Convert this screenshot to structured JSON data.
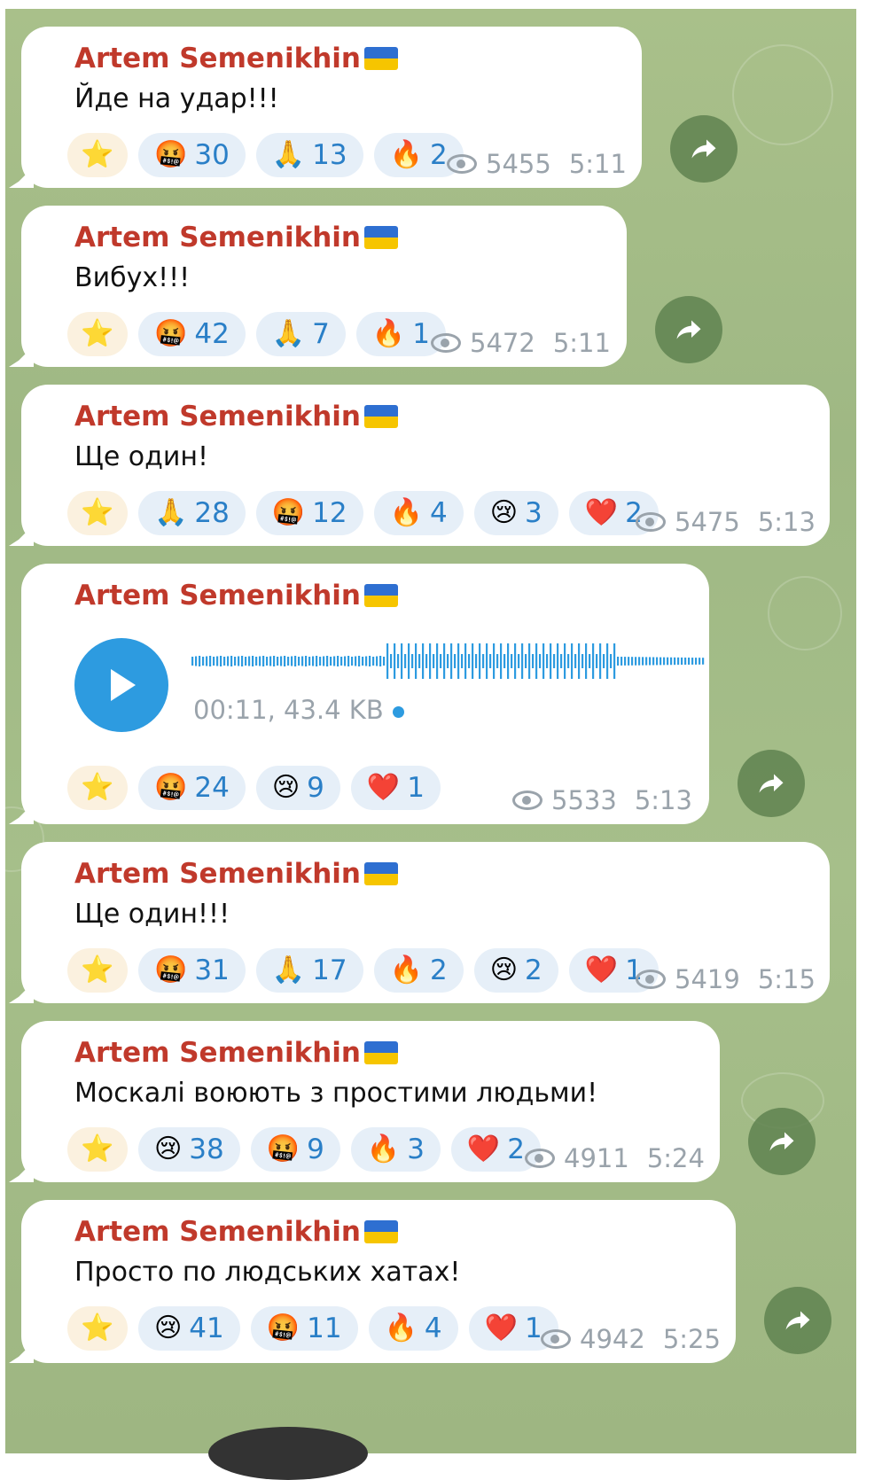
{
  "author": "Artem Semenikhin",
  "author_flag": "ukraine-flag-emoji",
  "colors": {
    "author": "#c0392b",
    "count": "#2a7fc7",
    "background": "#a6bf8a",
    "voice_play": "#2d9be0"
  },
  "messages": [
    {
      "text": "Йде на удар!!!",
      "reactions": [
        {
          "emoji": "⭐",
          "count": ""
        },
        {
          "emoji": "🤬",
          "count": "30"
        },
        {
          "emoji": "🙏",
          "count": "13"
        },
        {
          "emoji": "🔥",
          "count": "2"
        }
      ],
      "views": "5455",
      "time": "5:11"
    },
    {
      "text": "Вибух!!!",
      "reactions": [
        {
          "emoji": "⭐",
          "count": ""
        },
        {
          "emoji": "🤬",
          "count": "42"
        },
        {
          "emoji": "🙏",
          "count": "7"
        },
        {
          "emoji": "🔥",
          "count": "1"
        }
      ],
      "views": "5472",
      "time": "5:11"
    },
    {
      "text": "Ще один!",
      "reactions": [
        {
          "emoji": "⭐",
          "count": ""
        },
        {
          "emoji": "🙏",
          "count": "28"
        },
        {
          "emoji": "🤬",
          "count": "12"
        },
        {
          "emoji": "🔥",
          "count": "4"
        },
        {
          "emoji": "😢",
          "count": "3"
        },
        {
          "emoji": "❤️",
          "count": "2"
        }
      ],
      "views": "5475",
      "time": "5:13"
    },
    {
      "voice": {
        "duration": "00:11, 43.4 KB"
      },
      "reactions": [
        {
          "emoji": "⭐",
          "count": ""
        },
        {
          "emoji": "🤬",
          "count": "24"
        },
        {
          "emoji": "😢",
          "count": "9"
        },
        {
          "emoji": "❤️",
          "count": "1"
        }
      ],
      "views": "5533",
      "time": "5:13"
    },
    {
      "text": "Ще один!!!",
      "reactions": [
        {
          "emoji": "⭐",
          "count": ""
        },
        {
          "emoji": "🤬",
          "count": "31"
        },
        {
          "emoji": "🙏",
          "count": "17"
        },
        {
          "emoji": "🔥",
          "count": "2"
        },
        {
          "emoji": "😢",
          "count": "2"
        },
        {
          "emoji": "❤️",
          "count": "1"
        }
      ],
      "views": "5419",
      "time": "5:15"
    },
    {
      "text": "Москалі воюють з простими людьми!",
      "reactions": [
        {
          "emoji": "⭐",
          "count": ""
        },
        {
          "emoji": "😢",
          "count": "38"
        },
        {
          "emoji": "🤬",
          "count": "9"
        },
        {
          "emoji": "🔥",
          "count": "3"
        },
        {
          "emoji": "❤️",
          "count": "2"
        }
      ],
      "views": "4911",
      "time": "5:24"
    },
    {
      "text": "Просто по людських хатах!",
      "reactions": [
        {
          "emoji": "⭐",
          "count": ""
        },
        {
          "emoji": "😢",
          "count": "41"
        },
        {
          "emoji": "🤬",
          "count": "11"
        },
        {
          "emoji": "🔥",
          "count": "4"
        },
        {
          "emoji": "❤️",
          "count": "1"
        }
      ],
      "views": "4942",
      "time": "5:25"
    }
  ]
}
